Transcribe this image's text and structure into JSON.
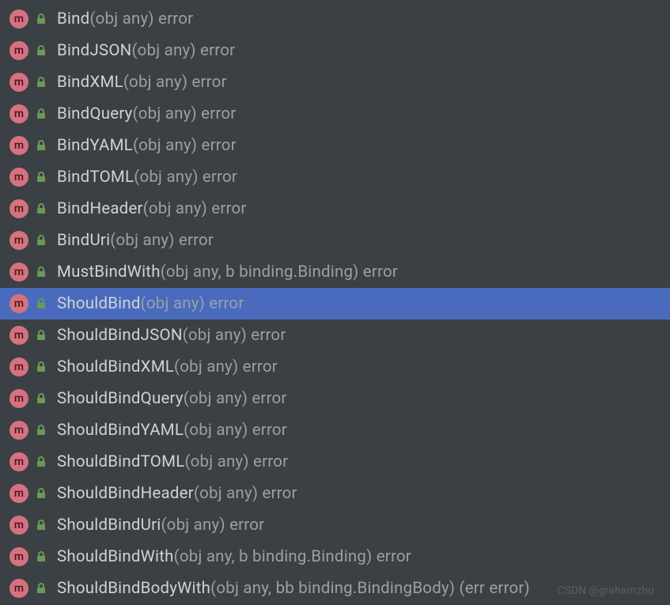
{
  "completions": [
    {
      "name": "Bind",
      "signature": "(obj any) error",
      "selected": false
    },
    {
      "name": "BindJSON",
      "signature": "(obj any) error",
      "selected": false
    },
    {
      "name": "BindXML",
      "signature": "(obj any) error",
      "selected": false
    },
    {
      "name": "BindQuery",
      "signature": "(obj any) error",
      "selected": false
    },
    {
      "name": "BindYAML",
      "signature": "(obj any) error",
      "selected": false
    },
    {
      "name": "BindTOML",
      "signature": "(obj any) error",
      "selected": false
    },
    {
      "name": "BindHeader",
      "signature": "(obj any) error",
      "selected": false
    },
    {
      "name": "BindUri",
      "signature": "(obj any) error",
      "selected": false
    },
    {
      "name": "MustBindWith",
      "signature": "(obj any, b binding.Binding) error",
      "selected": false
    },
    {
      "name": "ShouldBind",
      "signature": "(obj any) error",
      "selected": true
    },
    {
      "name": "ShouldBindJSON",
      "signature": "(obj any) error",
      "selected": false
    },
    {
      "name": "ShouldBindXML",
      "signature": "(obj any) error",
      "selected": false
    },
    {
      "name": "ShouldBindQuery",
      "signature": "(obj any) error",
      "selected": false
    },
    {
      "name": "ShouldBindYAML",
      "signature": "(obj any) error",
      "selected": false
    },
    {
      "name": "ShouldBindTOML",
      "signature": "(obj any) error",
      "selected": false
    },
    {
      "name": "ShouldBindHeader",
      "signature": "(obj any) error",
      "selected": false
    },
    {
      "name": "ShouldBindUri",
      "signature": "(obj any) error",
      "selected": false
    },
    {
      "name": "ShouldBindWith",
      "signature": "(obj any, b binding.Binding) error",
      "selected": false
    },
    {
      "name": "ShouldBindBodyWith",
      "signature": "(obj any, bb binding.BindingBody) (err error)",
      "selected": false
    }
  ],
  "icons": {
    "method_letter": "m"
  },
  "watermark": "CSDN @grahamzhu"
}
